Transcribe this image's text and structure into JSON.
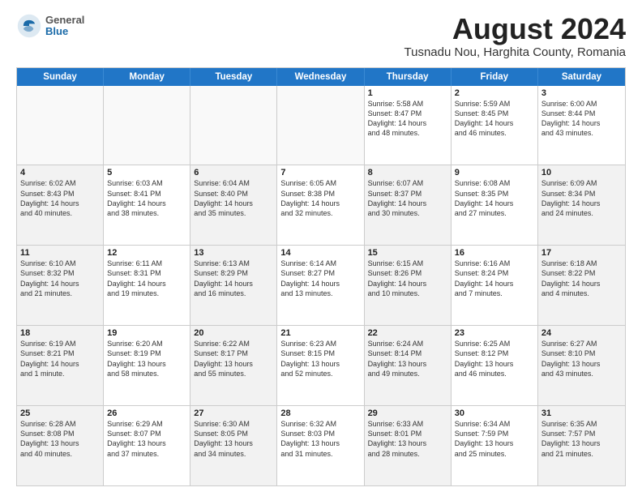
{
  "logo": {
    "general": "General",
    "blue": "Blue"
  },
  "title": "August 2024",
  "location": "Tusnadu Nou, Harghita County, Romania",
  "header_days": [
    "Sunday",
    "Monday",
    "Tuesday",
    "Wednesday",
    "Thursday",
    "Friday",
    "Saturday"
  ],
  "weeks": [
    [
      {
        "day": "",
        "info": "",
        "shaded": true
      },
      {
        "day": "",
        "info": "",
        "shaded": true
      },
      {
        "day": "",
        "info": "",
        "shaded": true
      },
      {
        "day": "",
        "info": "",
        "shaded": true
      },
      {
        "day": "1",
        "info": "Sunrise: 5:58 AM\nSunset: 8:47 PM\nDaylight: 14 hours\nand 48 minutes.",
        "shaded": false
      },
      {
        "day": "2",
        "info": "Sunrise: 5:59 AM\nSunset: 8:45 PM\nDaylight: 14 hours\nand 46 minutes.",
        "shaded": false
      },
      {
        "day": "3",
        "info": "Sunrise: 6:00 AM\nSunset: 8:44 PM\nDaylight: 14 hours\nand 43 minutes.",
        "shaded": false
      }
    ],
    [
      {
        "day": "4",
        "info": "Sunrise: 6:02 AM\nSunset: 8:43 PM\nDaylight: 14 hours\nand 40 minutes.",
        "shaded": true
      },
      {
        "day": "5",
        "info": "Sunrise: 6:03 AM\nSunset: 8:41 PM\nDaylight: 14 hours\nand 38 minutes.",
        "shaded": false
      },
      {
        "day": "6",
        "info": "Sunrise: 6:04 AM\nSunset: 8:40 PM\nDaylight: 14 hours\nand 35 minutes.",
        "shaded": true
      },
      {
        "day": "7",
        "info": "Sunrise: 6:05 AM\nSunset: 8:38 PM\nDaylight: 14 hours\nand 32 minutes.",
        "shaded": false
      },
      {
        "day": "8",
        "info": "Sunrise: 6:07 AM\nSunset: 8:37 PM\nDaylight: 14 hours\nand 30 minutes.",
        "shaded": true
      },
      {
        "day": "9",
        "info": "Sunrise: 6:08 AM\nSunset: 8:35 PM\nDaylight: 14 hours\nand 27 minutes.",
        "shaded": false
      },
      {
        "day": "10",
        "info": "Sunrise: 6:09 AM\nSunset: 8:34 PM\nDaylight: 14 hours\nand 24 minutes.",
        "shaded": true
      }
    ],
    [
      {
        "day": "11",
        "info": "Sunrise: 6:10 AM\nSunset: 8:32 PM\nDaylight: 14 hours\nand 21 minutes.",
        "shaded": true
      },
      {
        "day": "12",
        "info": "Sunrise: 6:11 AM\nSunset: 8:31 PM\nDaylight: 14 hours\nand 19 minutes.",
        "shaded": false
      },
      {
        "day": "13",
        "info": "Sunrise: 6:13 AM\nSunset: 8:29 PM\nDaylight: 14 hours\nand 16 minutes.",
        "shaded": true
      },
      {
        "day": "14",
        "info": "Sunrise: 6:14 AM\nSunset: 8:27 PM\nDaylight: 14 hours\nand 13 minutes.",
        "shaded": false
      },
      {
        "day": "15",
        "info": "Sunrise: 6:15 AM\nSunset: 8:26 PM\nDaylight: 14 hours\nand 10 minutes.",
        "shaded": true
      },
      {
        "day": "16",
        "info": "Sunrise: 6:16 AM\nSunset: 8:24 PM\nDaylight: 14 hours\nand 7 minutes.",
        "shaded": false
      },
      {
        "day": "17",
        "info": "Sunrise: 6:18 AM\nSunset: 8:22 PM\nDaylight: 14 hours\nand 4 minutes.",
        "shaded": true
      }
    ],
    [
      {
        "day": "18",
        "info": "Sunrise: 6:19 AM\nSunset: 8:21 PM\nDaylight: 14 hours\nand 1 minute.",
        "shaded": true
      },
      {
        "day": "19",
        "info": "Sunrise: 6:20 AM\nSunset: 8:19 PM\nDaylight: 13 hours\nand 58 minutes.",
        "shaded": false
      },
      {
        "day": "20",
        "info": "Sunrise: 6:22 AM\nSunset: 8:17 PM\nDaylight: 13 hours\nand 55 minutes.",
        "shaded": true
      },
      {
        "day": "21",
        "info": "Sunrise: 6:23 AM\nSunset: 8:15 PM\nDaylight: 13 hours\nand 52 minutes.",
        "shaded": false
      },
      {
        "day": "22",
        "info": "Sunrise: 6:24 AM\nSunset: 8:14 PM\nDaylight: 13 hours\nand 49 minutes.",
        "shaded": true
      },
      {
        "day": "23",
        "info": "Sunrise: 6:25 AM\nSunset: 8:12 PM\nDaylight: 13 hours\nand 46 minutes.",
        "shaded": false
      },
      {
        "day": "24",
        "info": "Sunrise: 6:27 AM\nSunset: 8:10 PM\nDaylight: 13 hours\nand 43 minutes.",
        "shaded": true
      }
    ],
    [
      {
        "day": "25",
        "info": "Sunrise: 6:28 AM\nSunset: 8:08 PM\nDaylight: 13 hours\nand 40 minutes.",
        "shaded": true
      },
      {
        "day": "26",
        "info": "Sunrise: 6:29 AM\nSunset: 8:07 PM\nDaylight: 13 hours\nand 37 minutes.",
        "shaded": false
      },
      {
        "day": "27",
        "info": "Sunrise: 6:30 AM\nSunset: 8:05 PM\nDaylight: 13 hours\nand 34 minutes.",
        "shaded": true
      },
      {
        "day": "28",
        "info": "Sunrise: 6:32 AM\nSunset: 8:03 PM\nDaylight: 13 hours\nand 31 minutes.",
        "shaded": false
      },
      {
        "day": "29",
        "info": "Sunrise: 6:33 AM\nSunset: 8:01 PM\nDaylight: 13 hours\nand 28 minutes.",
        "shaded": true
      },
      {
        "day": "30",
        "info": "Sunrise: 6:34 AM\nSunset: 7:59 PM\nDaylight: 13 hours\nand 25 minutes.",
        "shaded": false
      },
      {
        "day": "31",
        "info": "Sunrise: 6:35 AM\nSunset: 7:57 PM\nDaylight: 13 hours\nand 21 minutes.",
        "shaded": true
      }
    ]
  ]
}
